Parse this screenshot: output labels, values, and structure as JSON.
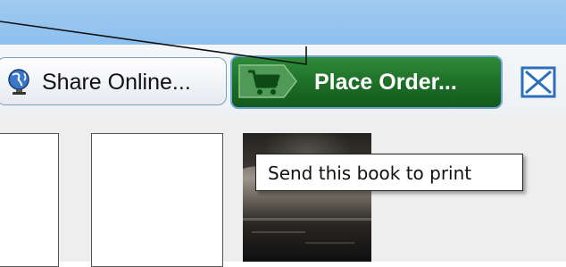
{
  "toolbar": {
    "share_online_label": "Share Online...",
    "share_online_icon": "globe-icon",
    "place_order_label": "Place Order...",
    "place_order_icon": "cart-icon",
    "close_icon": "close-icon"
  },
  "tooltip": {
    "text": "Send this book to print"
  },
  "thumbnails": [
    {
      "kind": "empty"
    },
    {
      "kind": "empty"
    },
    {
      "kind": "photo"
    }
  ],
  "colors": {
    "header_blue": "#8ec0ee",
    "order_green": "#1b6b25",
    "close_blue": "#2a6fb9"
  }
}
